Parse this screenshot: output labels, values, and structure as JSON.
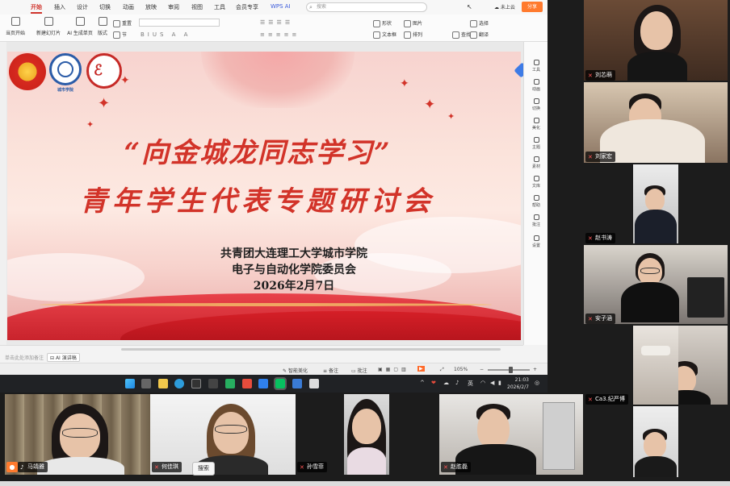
{
  "wps": {
    "tabs": [
      "开始",
      "插入",
      "设计",
      "切换",
      "动画",
      "放映",
      "审阅",
      "视图",
      "工具",
      "会员专享",
      "WPS AI"
    ],
    "active_tab": "开始",
    "search_placeholder": "搜索",
    "cloud_status": "未上云",
    "share_label": "分享",
    "ribbon": {
      "play_from_start": "当页开始",
      "new_slide": "新建幻灯片",
      "ai_generate": "AI 生成单页",
      "layout": "版式",
      "reset": "重置",
      "section": "节",
      "shape": "形状",
      "image": "图片",
      "textbox": "文本框",
      "arrange": "排列",
      "select": "选择",
      "find": "查找",
      "translate": "翻译"
    },
    "side_panel": [
      "工具",
      "动画",
      "切换",
      "美化",
      "主题",
      "素材",
      "文库",
      "帮助",
      "批注",
      "设置"
    ],
    "notes_placeholder": "单击此处添加备注",
    "ai_notes": "AI 演讲稿",
    "status": {
      "smart_beautify": "智能美化",
      "notes": "备注",
      "comments": "批注",
      "zoom": "105%"
    }
  },
  "slide": {
    "title_line1": "“向金城龙同志学习”",
    "title_line2": "青年学生代表专题研讨会",
    "org_line1": "共青团大连理工大学城市学院",
    "org_line2": "电子与自动化学院委员会",
    "date": "2026年2月7日",
    "logo_caption": "城市学院"
  },
  "taskbar": {
    "ime": "英",
    "time": "21:03",
    "date": "2026/2/7"
  },
  "participants": {
    "right": [
      "刘芯萌",
      "刘家宏",
      "赵书涛",
      "安子涵",
      "Ca3.纪严博",
      ""
    ],
    "bottom": [
      "马靖雅",
      "何佳琪",
      "孙雪菲",
      "赵胜磊"
    ]
  },
  "tooltip": "搜索",
  "colors": {
    "accent_red": "#d23329",
    "share_orange": "#ff7a2e",
    "taskbar": "#202225"
  }
}
